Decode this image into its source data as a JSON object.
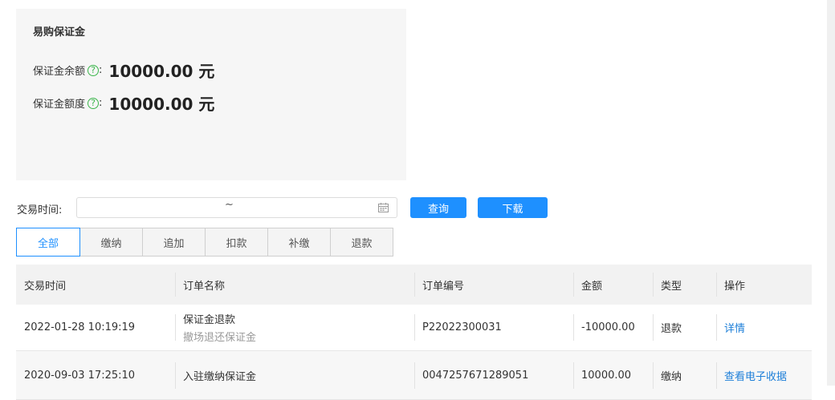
{
  "deposit": {
    "title": "易购保证金",
    "balance_label": "保证金余额",
    "balance_value": "10000.00 元",
    "quota_label": "保证金额度",
    "quota_value": "10000.00 元",
    "help_glyph": "?",
    "colon": ":"
  },
  "filter": {
    "label": "交易时间:",
    "range_separator": "~",
    "query_button": "查询",
    "download_button": "下载"
  },
  "tabs": [
    "全部",
    "缴纳",
    "追加",
    "扣款",
    "补缴",
    "退款"
  ],
  "table": {
    "headers": [
      "交易时间",
      "订单名称",
      "订单编号",
      "金额",
      "类型",
      "操作"
    ],
    "rows": [
      {
        "time": "2022-01-28 10:19:19",
        "name": "保证金退款",
        "subname": "撤场退还保证金",
        "order_no": "P22022300031",
        "amount": "-10000.00",
        "type": "退款",
        "action": "详情"
      },
      {
        "time": "2020-09-03 17:25:10",
        "name": "入驻缴纳保证金",
        "subname": "",
        "order_no": "0047257671289051",
        "amount": "10000.00",
        "type": "缴纳",
        "action": "查看电子收据"
      }
    ]
  },
  "colors": {
    "accent": "#1e90ff",
    "help_green": "#3ab54a",
    "link": "#1e7fd8"
  }
}
